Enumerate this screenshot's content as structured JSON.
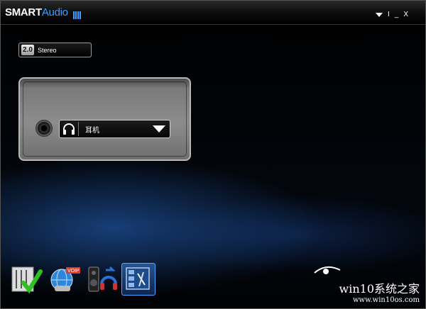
{
  "titlebar": {
    "logo_smart": "SMART",
    "logo_audio": "Audio",
    "minimize_label": "_",
    "close_label": "X",
    "separator_label": "I"
  },
  "config": {
    "badge": "2.0",
    "label": "Stereo"
  },
  "device_panel": {
    "output_selected": "耳机"
  },
  "taskbar": {
    "items": [
      {
        "icon": "check-audio-icon"
      },
      {
        "icon": "voip-globe-icon",
        "badge": "VOIP"
      },
      {
        "icon": "speakers-headphones-icon"
      },
      {
        "icon": "audio-director-icon"
      }
    ],
    "selected_index": 3
  },
  "watermark": {
    "line1": "win10系统之家",
    "line2": "www.win10os.com"
  },
  "colors": {
    "accent": "#3aa0ff",
    "selected_tab": "#4da6ff"
  }
}
